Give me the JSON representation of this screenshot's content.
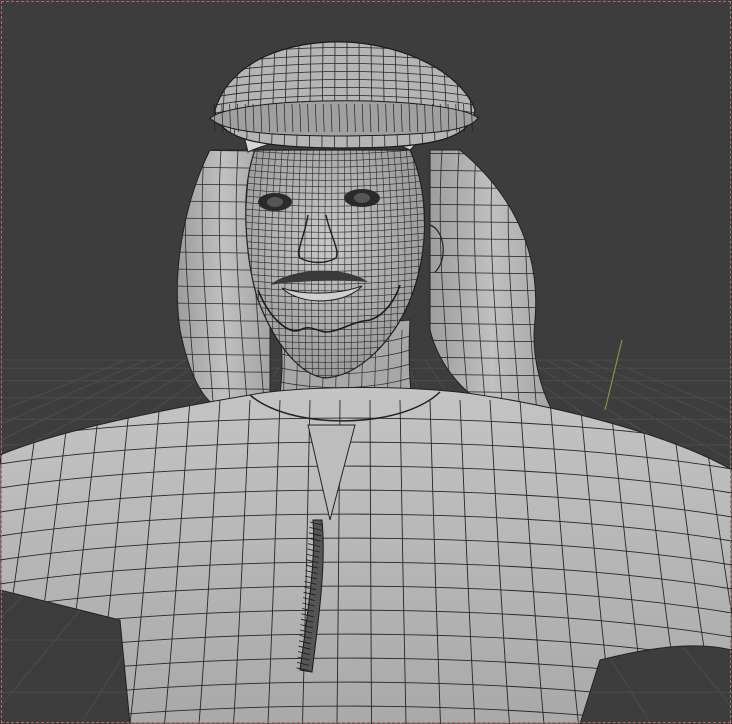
{
  "app": {
    "name": "3D viewport",
    "mode": "wireframe-over-solid"
  },
  "scene": {
    "subject": "character-bust",
    "items": [
      "ghutra-headcloth",
      "agal-ring",
      "head-mesh",
      "neck-mesh",
      "thobe-torso",
      "tassel-cord"
    ]
  },
  "colors": {
    "background": "#3d3d3d",
    "floor_grid": "#4a4a4a",
    "mesh_fill": "#b8b8b8",
    "mesh_shadow": "#8a8a8a",
    "wire": "#1f1f1f",
    "y_axis": "#7a9a3a",
    "frame_border": "#b06a6a"
  }
}
